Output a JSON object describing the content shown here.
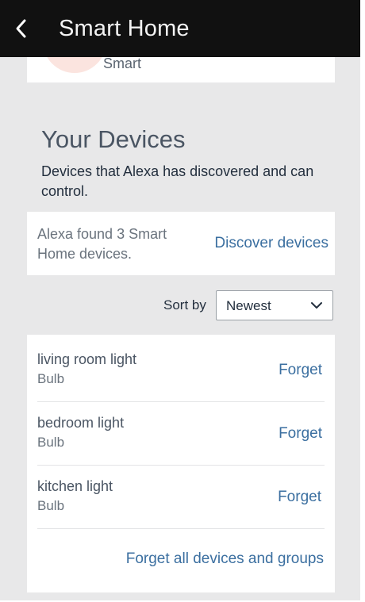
{
  "header": {
    "title": "Smart Home",
    "back_icon": "chevron-left-icon"
  },
  "partial_card": {
    "text": "Smart"
  },
  "devices_section": {
    "heading": "Your Devices",
    "description": "Devices that Alexa has discovered and can control."
  },
  "discovery": {
    "found_text": "Alexa found 3 Smart Home devices.",
    "discover_label": "Discover devices"
  },
  "sort": {
    "label": "Sort by",
    "selected": "Newest"
  },
  "devices": [
    {
      "name": "living room light",
      "type": "Bulb",
      "action": "Forget"
    },
    {
      "name": "bedroom light",
      "type": "Bulb",
      "action": "Forget"
    },
    {
      "name": "kitchen light",
      "type": "Bulb",
      "action": "Forget"
    }
  ],
  "forget_all_label": "Forget all devices and groups",
  "colors": {
    "topbar": "#111111",
    "background": "#e8e8e9",
    "link": "#3b6fa0",
    "card": "#ffffff"
  }
}
